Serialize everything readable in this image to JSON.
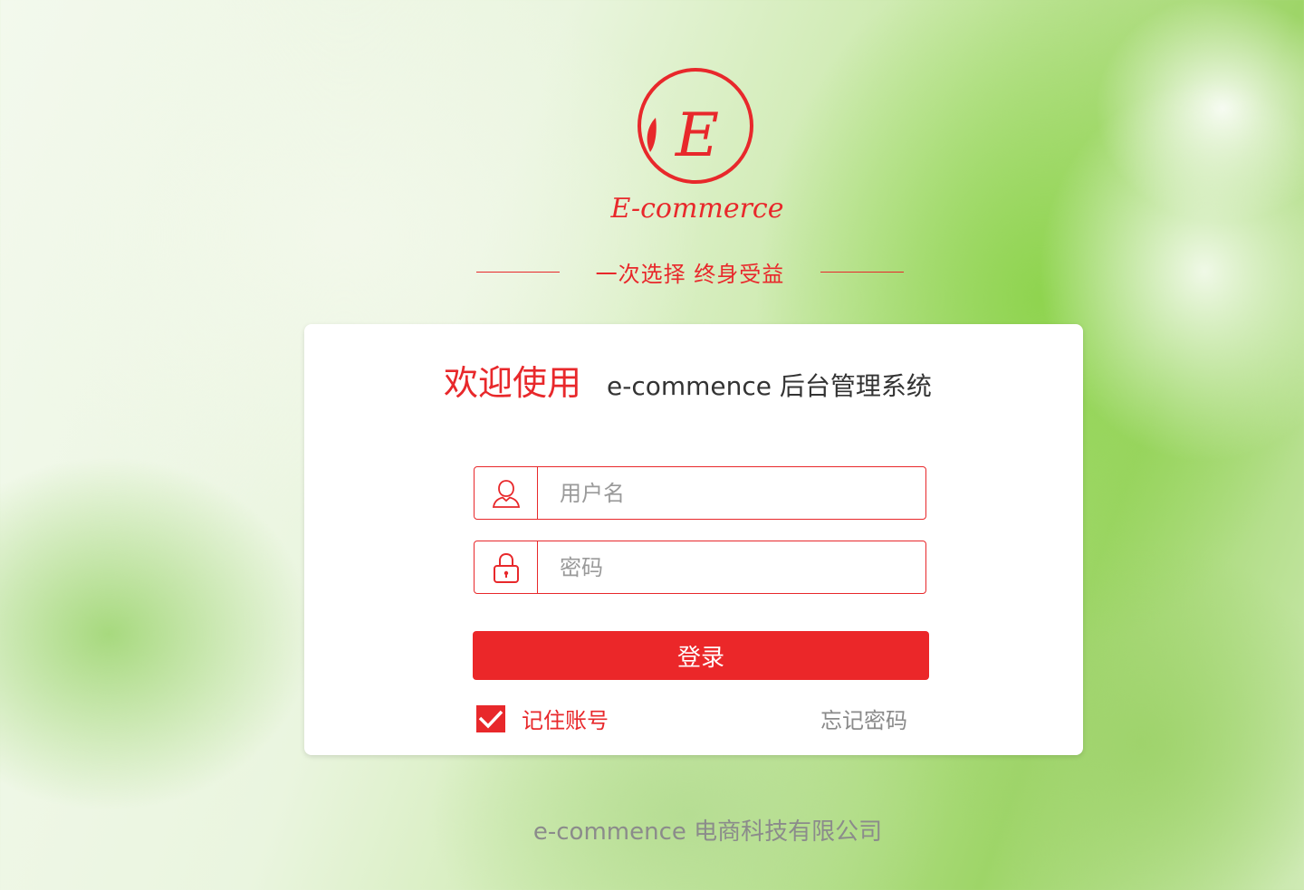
{
  "brand": {
    "logo_text": "E-commerce",
    "logo_letter": "E"
  },
  "slogan": "一次选择 终身受益",
  "card": {
    "welcome_main": "欢迎使用",
    "welcome_sub": "e-commence 后台管理系统"
  },
  "form": {
    "username_placeholder": "用户名",
    "username_value": "",
    "password_placeholder": "密码",
    "password_value": "",
    "login_label": "登录",
    "remember_label": "记住账号",
    "remember_checked": true,
    "forgot_label": "忘记密码"
  },
  "footer": "e-commence 电商科技有限公司",
  "colors": {
    "accent": "#e8282b",
    "button": "#eb2729",
    "muted": "#8b8b8b"
  },
  "icons": [
    "user-icon",
    "lock-icon",
    "check-icon"
  ]
}
